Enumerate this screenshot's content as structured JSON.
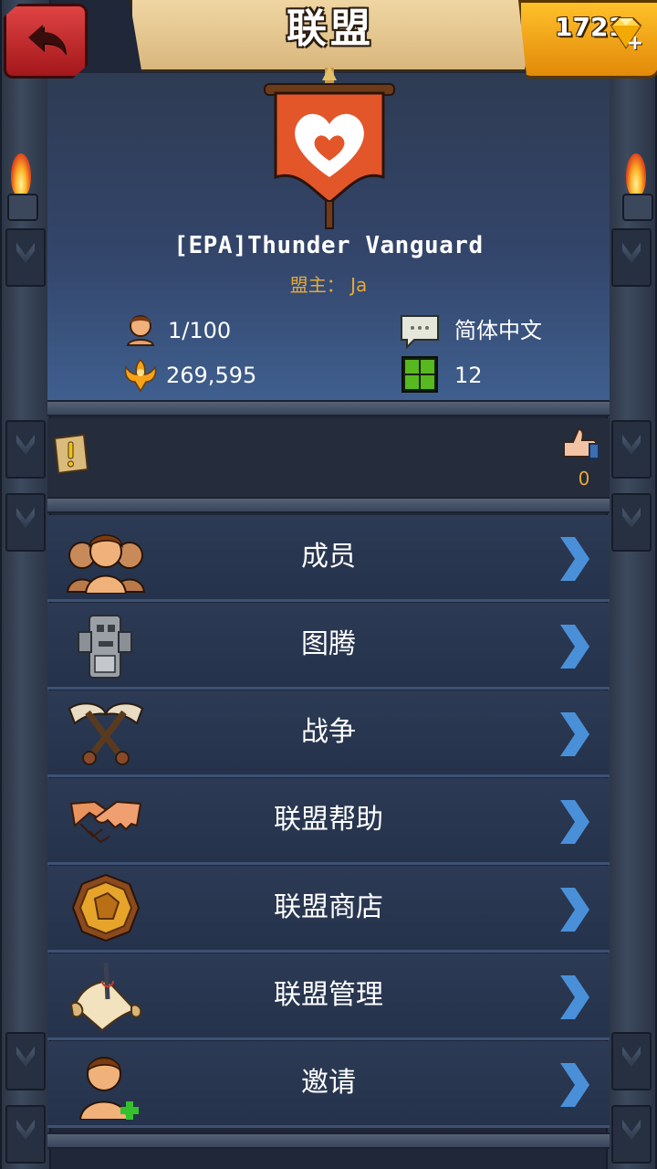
{
  "header": {
    "title": "联盟",
    "gems": "1721",
    "plus": "+"
  },
  "alliance": {
    "name": "[EPA]Thunder Vanguard",
    "leader": "盟主： Ja",
    "members": "1/100",
    "power": "269,595",
    "language": "简体中文",
    "level": "12",
    "likes": "0"
  },
  "menu": [
    {
      "label": "成员",
      "icon": "members-icon"
    },
    {
      "label": "图腾",
      "icon": "totem-icon"
    },
    {
      "label": "战争",
      "icon": "war-axes-icon"
    },
    {
      "label": "联盟帮助",
      "icon": "handshake-icon"
    },
    {
      "label": "联盟商店",
      "icon": "shop-coin-icon"
    },
    {
      "label": "联盟管理",
      "icon": "scroll-quill-icon"
    },
    {
      "label": "邀请",
      "icon": "invite-person-icon"
    }
  ],
  "colors": {
    "accent": "#e7a934",
    "chevron": "#4a90d9",
    "flag": "#e2562a",
    "back_button": "#d0302f",
    "gem_panel": "#f5a81c"
  }
}
